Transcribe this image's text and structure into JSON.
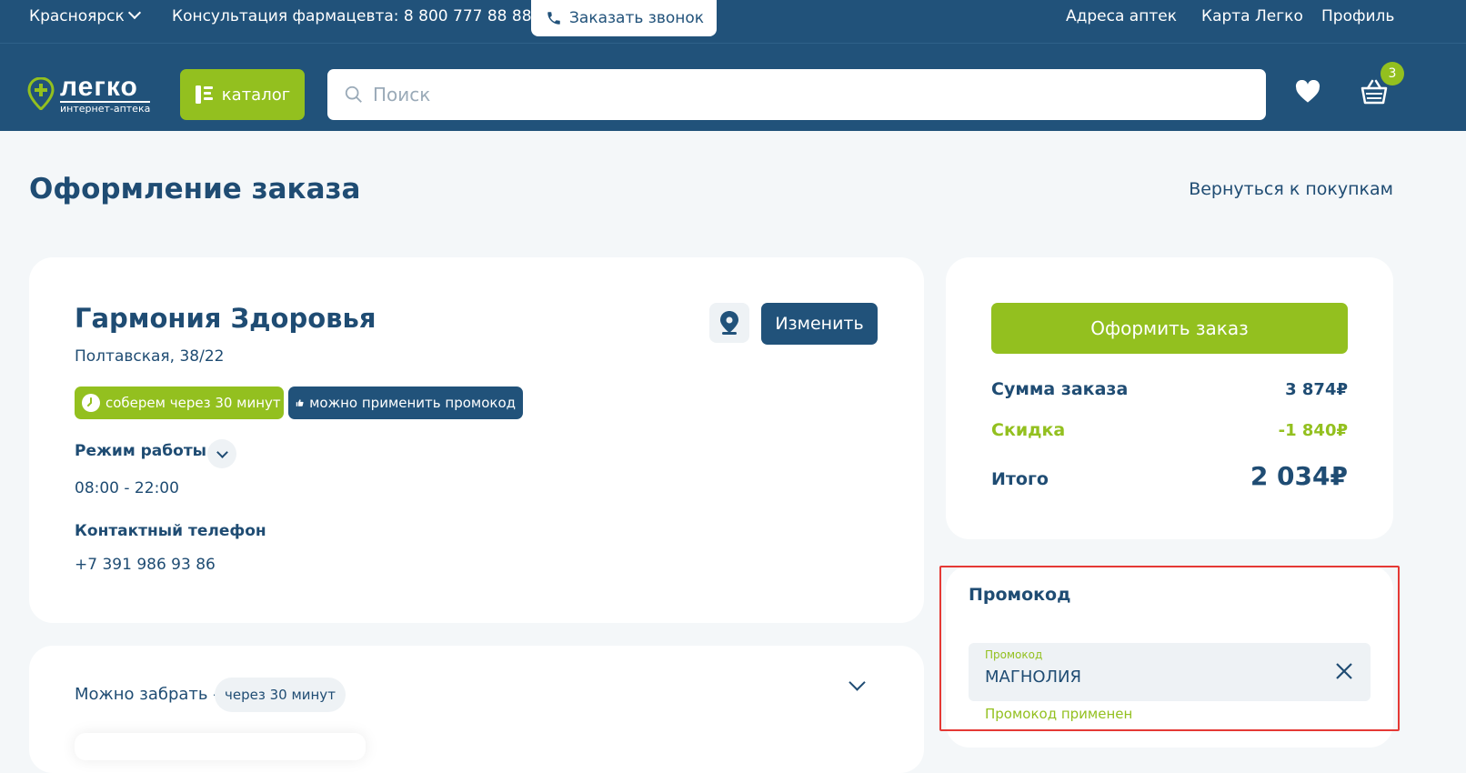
{
  "topbar": {
    "city": "Красноярск",
    "consult_label": "Консультация фармацевта: 8 800 777 88 88",
    "call_button": "Заказать звонок",
    "links": [
      "Адреса аптек",
      "Карта Легко",
      "Профиль"
    ]
  },
  "navbar": {
    "logo_main": "легко",
    "logo_sub": "интернет-аптека",
    "catalog_button": "каталог",
    "search_placeholder": "Поиск",
    "cart_count": "3"
  },
  "page": {
    "title": "Оформление заказа",
    "back_link": "Вернуться к покупкам"
  },
  "pharmacy": {
    "name": "Гармония Здоровья",
    "address": "Полтавская, 38/22",
    "tag_time": "соберем через 30 минут",
    "tag_promo": "можно применить промокод",
    "change_button": "Изменить",
    "hours_label": "Режим работы",
    "hours_value": "08:00 - 22:00",
    "phone_label": "Контактный телефон",
    "phone_value": "+7 391 986 93 86"
  },
  "pickup": {
    "label": "Можно забрать -",
    "chip": "через 30 минут"
  },
  "summary": {
    "order_button": "Оформить заказ",
    "sum_label": "Сумма заказа",
    "sum_value": "3 874₽",
    "discount_label": "Скидка",
    "discount_value": "-1 840₽",
    "total_label": "Итого",
    "total_value": "2 034₽"
  },
  "promo": {
    "title": "Промокод",
    "field_label": "Промокод",
    "field_value": "МАГНОЛИЯ",
    "status": "Промокод применен"
  },
  "colors": {
    "brand_blue": "#21527a",
    "brand_green": "#93c01f",
    "highlight_red": "#e53935"
  }
}
